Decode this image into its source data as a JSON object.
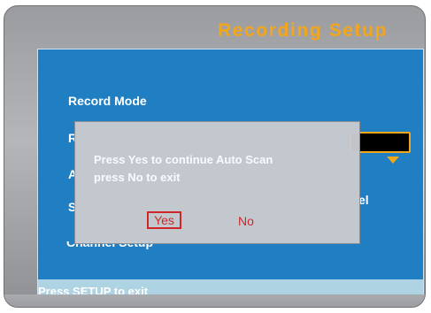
{
  "screen": {
    "title": "Recording Setup"
  },
  "menu": {
    "items": [
      {
        "label": "Record Mode"
      },
      {
        "label": "R"
      },
      {
        "label": "A"
      },
      {
        "label": "S"
      },
      {
        "label": "Channel Setup"
      }
    ],
    "partial_right_label": "el"
  },
  "dialog": {
    "line1": "Press Yes to continue Auto Scan",
    "line2": "press No to exit",
    "yes_label": "Yes",
    "no_label": "No"
  },
  "status_bar": {
    "text": "Press SETUP to exit"
  },
  "colors": {
    "title": "#f4a61a",
    "panel": "#1f7fc2",
    "selection": "#d52525",
    "dialog": "#c9cbd0"
  },
  "icons": {
    "dropdown": "dropdown-arrow-icon"
  }
}
